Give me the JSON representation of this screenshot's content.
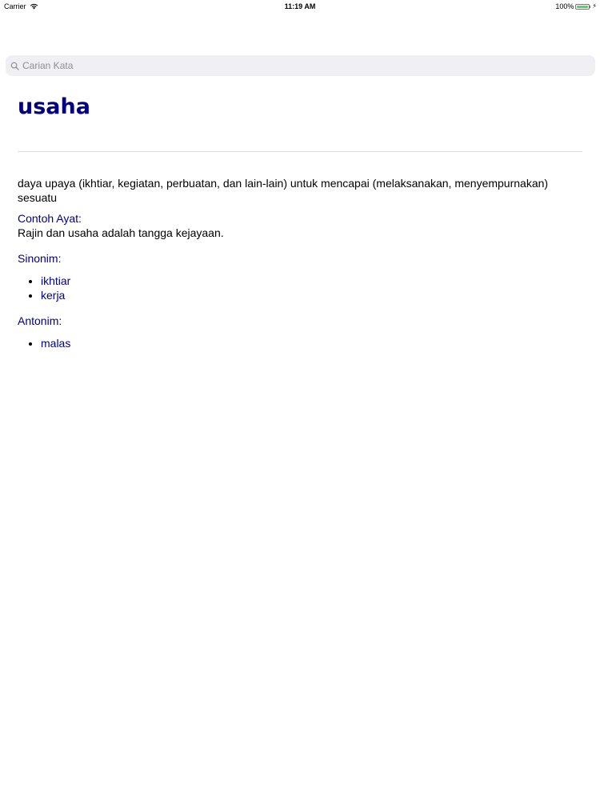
{
  "status_bar": {
    "carrier": "Carrier",
    "time": "11:19 AM",
    "battery": "100%",
    "battery_level": 1.0,
    "wifi_icon": "wifi-icon",
    "battery_color": "#4cd964"
  },
  "search": {
    "placeholder": "Carian Kata",
    "value": "",
    "icon": "search-icon"
  },
  "entry": {
    "word": "usaha",
    "definition": "daya upaya (ikhtiar, kegiatan, perbuatan, dan lain-lain) untuk mencapai (melaksanakan, menyempurnakan) sesuatu",
    "example_label": "Contoh Ayat:",
    "example": "Rajin dan usaha adalah tangga kejayaan.",
    "synonym_label": "Sinonim:",
    "synonyms": [
      "ikhtiar",
      "kerja"
    ],
    "antonym_label": "Antonim:",
    "antonyms": [
      "malas"
    ]
  },
  "colors": {
    "accent": "#000080",
    "search_bg": "#efeff4",
    "placeholder": "#8e8e93"
  }
}
